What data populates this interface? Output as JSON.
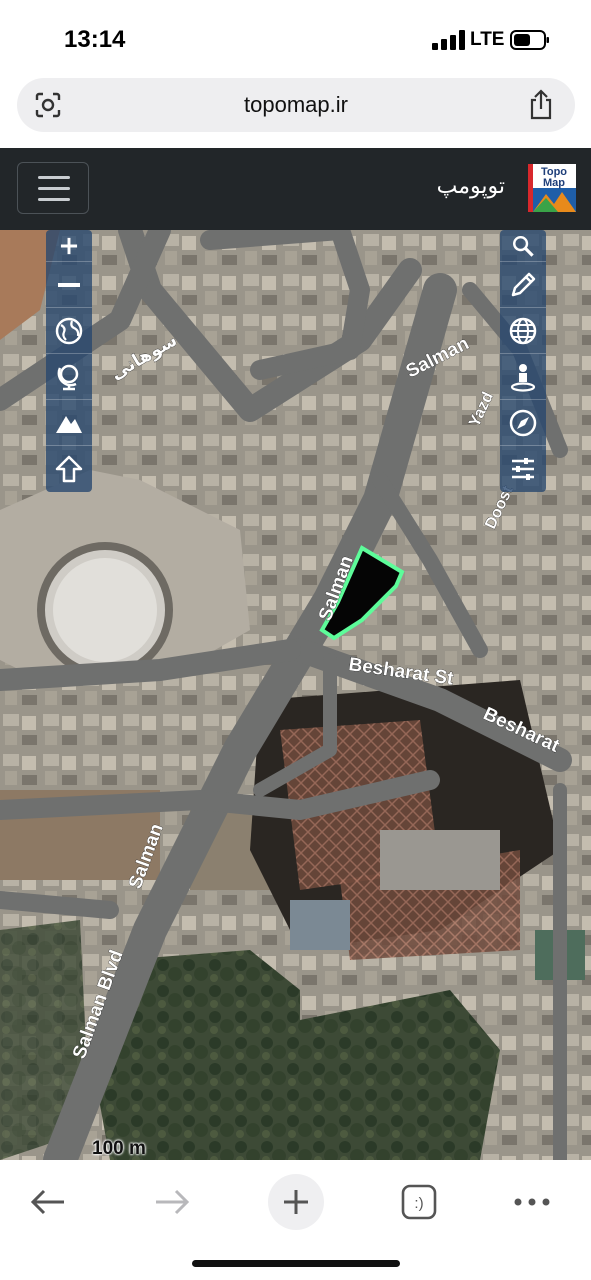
{
  "status": {
    "time": "13:14",
    "network": "LTE"
  },
  "browser": {
    "url": "topomap.ir"
  },
  "site": {
    "title": "توپومپ",
    "logo_line1": "Topo",
    "logo_line2": "Map"
  },
  "map": {
    "labels": {
      "persian_street": "سوهانی",
      "salman_top": "Salman",
      "yazd": "Yazd",
      "doost": "Doost",
      "salman_mid": "Salman",
      "besharat_st": "Besharat St",
      "besharat": "Besharat",
      "salman_low": "Salman",
      "salman_blvd": "Salman Blvd"
    },
    "scale": "100 m",
    "highlight_color": "#5dfc9a"
  },
  "left_tools": [
    "zoom-in-icon",
    "zoom-out-icon",
    "globe-icon",
    "globe-stand-icon",
    "mountain-icon",
    "arrow-up-icon"
  ],
  "right_tools": [
    "search-icon",
    "pencil-icon",
    "web-globe-icon",
    "person-pin-icon",
    "compass-icon",
    "sliders-icon"
  ],
  "colors": {
    "header_bg": "#222629",
    "toolbar_bg": "#26476e"
  }
}
